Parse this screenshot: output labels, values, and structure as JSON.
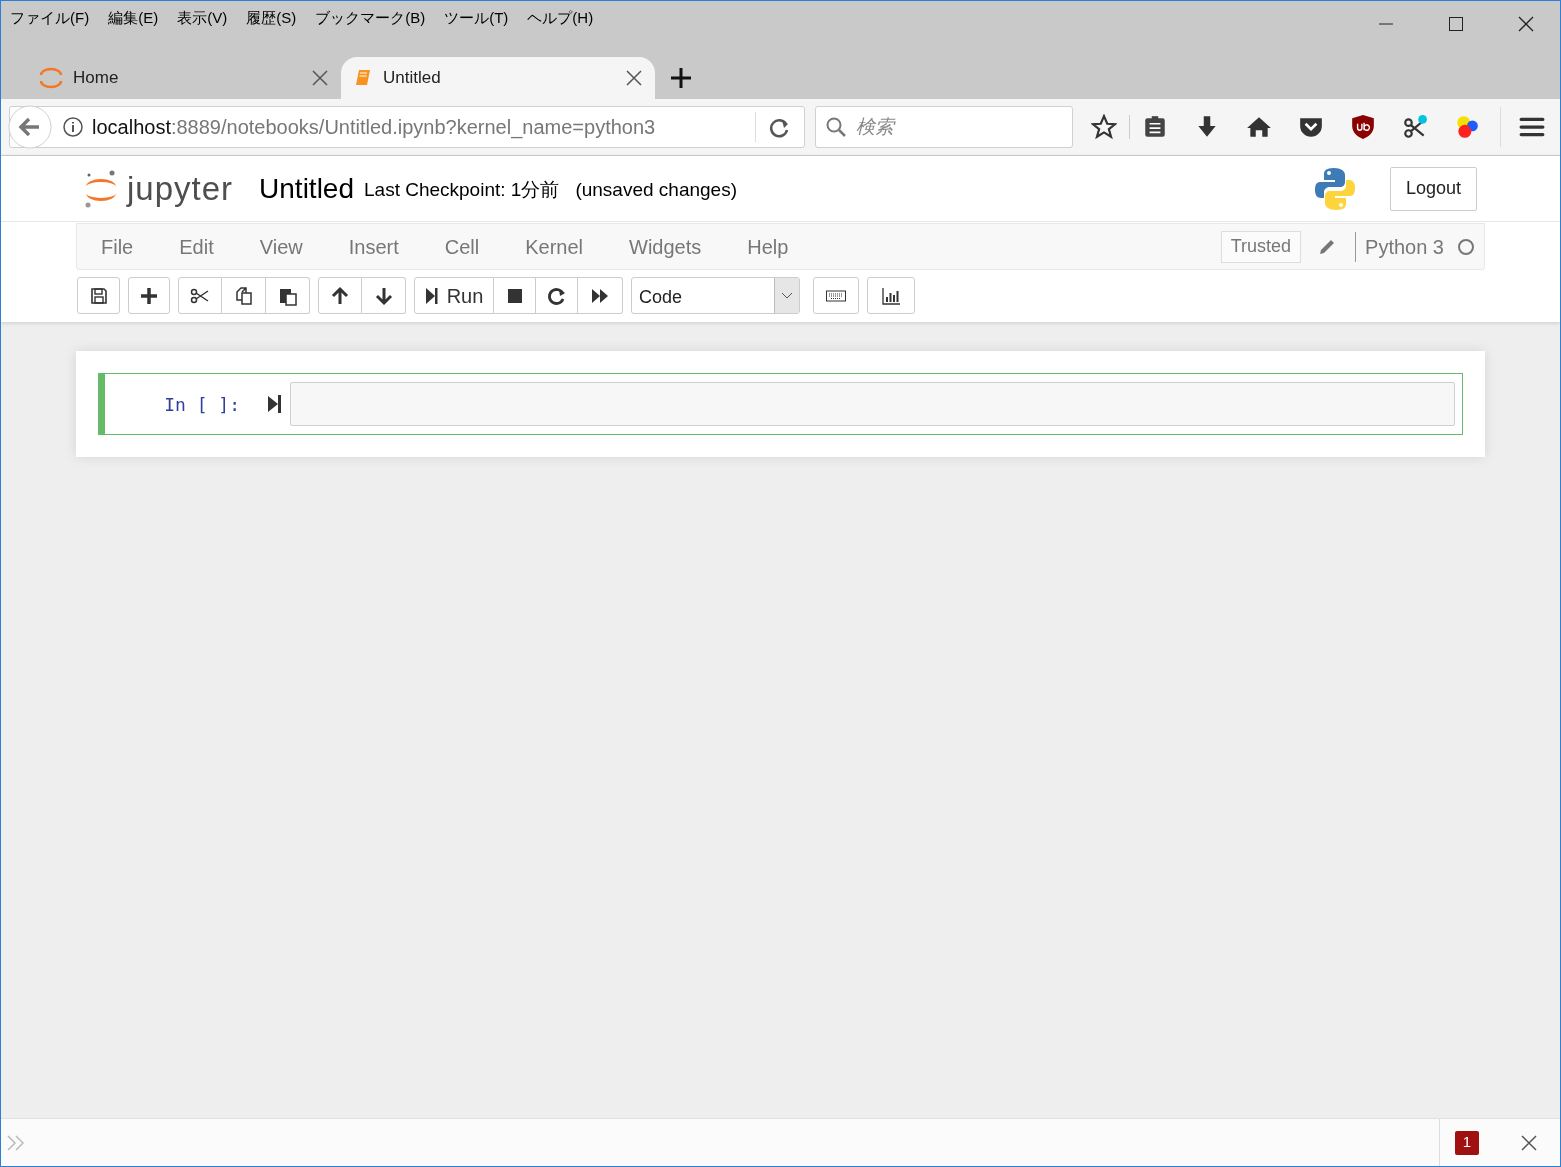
{
  "browser_menu": [
    "ファイル(F)",
    "編集(E)",
    "表示(V)",
    "履歴(S)",
    "ブックマーク(B)",
    "ツール(T)",
    "ヘルプ(H)"
  ],
  "tabs": [
    {
      "label": "Home",
      "selected": false,
      "kind": "jupyter"
    },
    {
      "label": "Untitled",
      "selected": true,
      "kind": "notebook"
    }
  ],
  "address": {
    "host": "localhost",
    "rest": ":8889/notebooks/Untitled.ipynb?kernel_name=python3"
  },
  "search": {
    "placeholder": "検索"
  },
  "header": {
    "logo_text": "jupyter",
    "notebook_name": "Untitled",
    "checkpoint": "Last Checkpoint: 1分前",
    "unsaved": "(unsaved changes)",
    "logout": "Logout"
  },
  "menu": [
    "File",
    "Edit",
    "View",
    "Insert",
    "Cell",
    "Kernel",
    "Widgets",
    "Help"
  ],
  "trusted": "Trusted",
  "kernel": "Python 3",
  "toolbar": {
    "run": "Run",
    "cell_type": "Code"
  },
  "cells": [
    {
      "prompt": "In [ ]:",
      "selected": true
    }
  ],
  "notification_badge": "1"
}
